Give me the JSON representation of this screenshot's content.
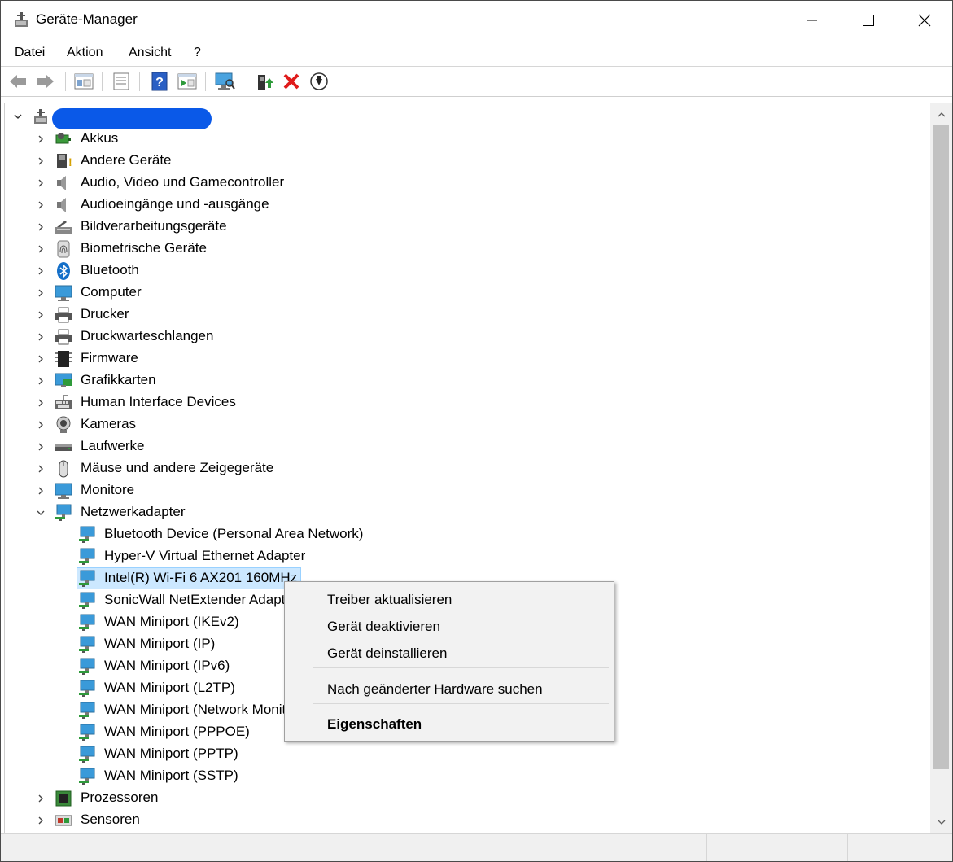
{
  "window": {
    "title": "Geräte-Manager"
  },
  "menu": [
    "Datei",
    "Aktion",
    "Ansicht",
    "?"
  ],
  "toolbar": {
    "back": "back-arrow-icon",
    "forward": "forward-arrow-icon",
    "show_hide_console": "console-tree-icon",
    "properties": "properties-icon",
    "help": "help-icon",
    "action_pane": "action-pane-icon",
    "scan": "scan-hardware-icon",
    "update_driver": "update-driver-icon",
    "uninstall": "uninstall-icon",
    "disable": "disable-device-icon"
  },
  "tree": {
    "root_label": "",
    "categories": [
      "Akkus",
      "Andere Geräte",
      "Audio, Video und Gamecontroller",
      "Audioeingänge und -ausgänge",
      "Bildverarbeitungsgeräte",
      "Biometrische Geräte",
      "Bluetooth",
      "Computer",
      "Drucker",
      "Druckwarteschlangen",
      "Firmware",
      "Grafikkarten",
      "Human Interface Devices",
      "Kameras",
      "Laufwerke",
      "Mäuse und andere Zeigegeräte",
      "Monitore",
      "Netzwerkadapter"
    ],
    "network_adapters": [
      "Bluetooth Device (Personal Area Network)",
      "Hyper-V Virtual Ethernet Adapter",
      "Intel(R) Wi-Fi 6 AX201 160MHz",
      "SonicWall NetExtender Adapter",
      "WAN Miniport (IKEv2)",
      "WAN Miniport (IP)",
      "WAN Miniport (IPv6)",
      "WAN Miniport (L2TP)",
      "WAN Miniport (Network Monitor)",
      "WAN Miniport (PPPOE)",
      "WAN Miniport (PPTP)",
      "WAN Miniport (SSTP)"
    ],
    "after": [
      "Prozessoren",
      "Sensoren"
    ],
    "selected": "Intel(R) Wi-Fi 6 AX201 160MHz"
  },
  "context_menu": {
    "update_driver": "Treiber aktualisieren",
    "disable": "Gerät deaktivieren",
    "uninstall": "Gerät deinstallieren",
    "scan": "Nach geänderter Hardware suchen",
    "properties": "Eigenschaften"
  },
  "colors": {
    "selection": "#cce8ff",
    "redaction": "#0a59e8",
    "menu_bg": "#f2f2f2"
  }
}
